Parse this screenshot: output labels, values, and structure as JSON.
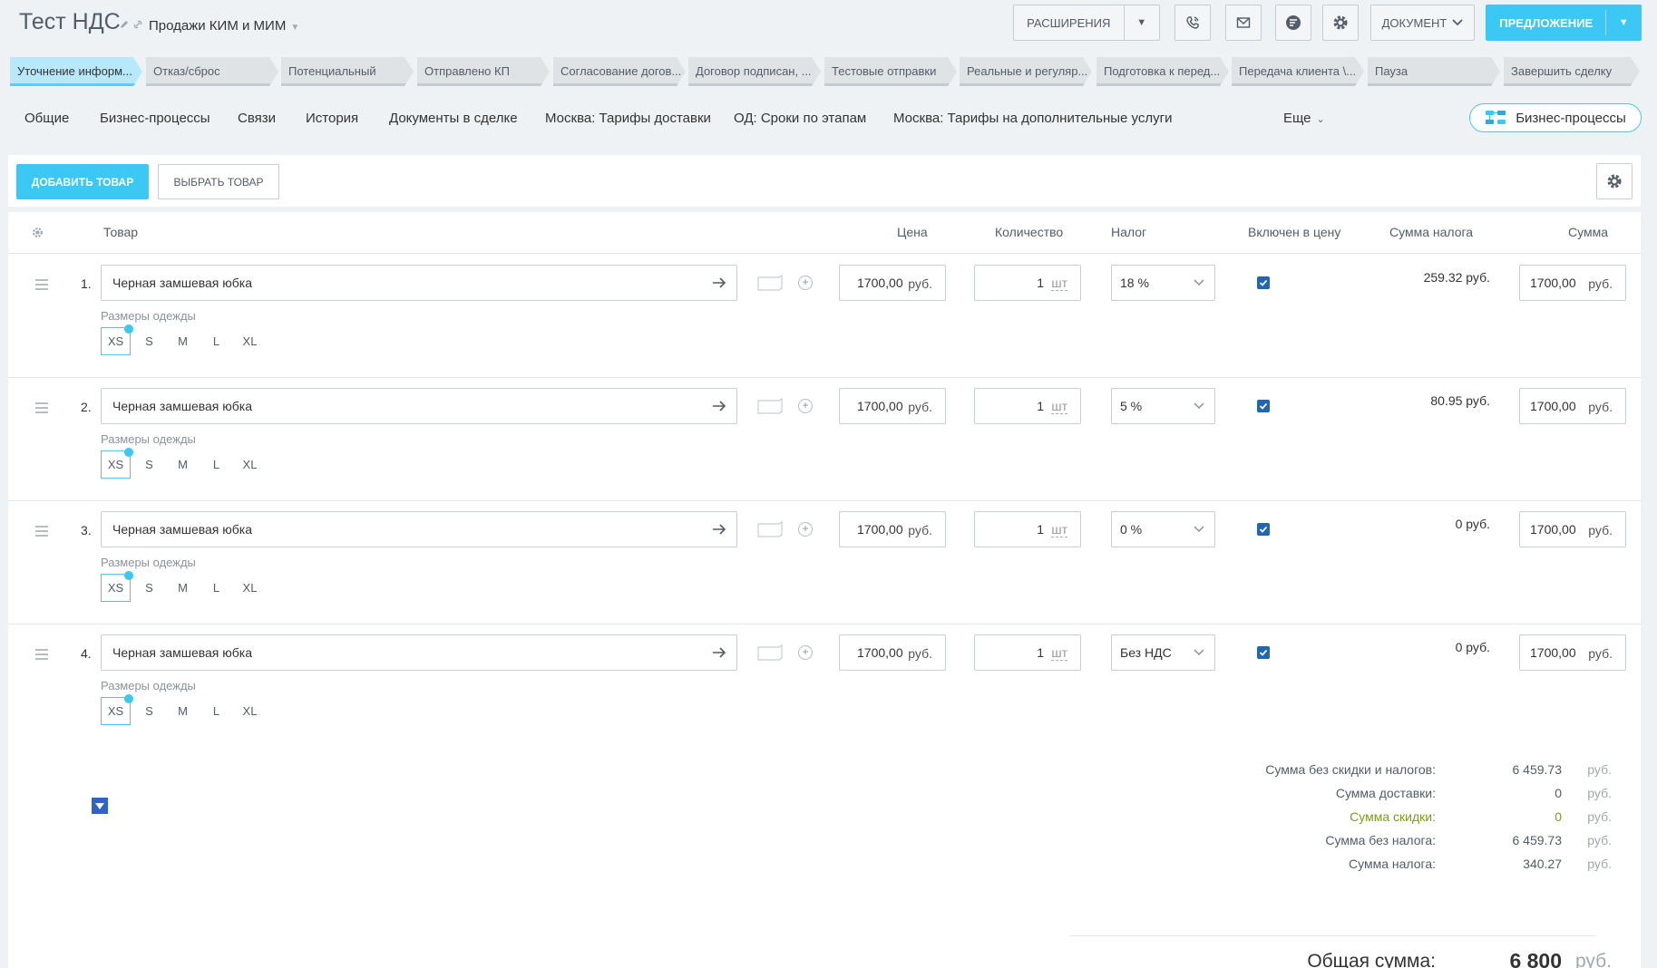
{
  "header": {
    "title": "Тест НДС",
    "pipeline": "Продажи КИМ и МИМ",
    "extensions_label": "Расширения",
    "document_label": "Документ",
    "offer_label": "Предложение"
  },
  "stages": [
    {
      "label": "Уточнение информ...",
      "active": true
    },
    {
      "label": "Отказ/сброс"
    },
    {
      "label": "Потенциальный"
    },
    {
      "label": "Отправлено КП"
    },
    {
      "label": "Согласование догов..."
    },
    {
      "label": "Договор подписан, ..."
    },
    {
      "label": "Тестовые отправки"
    },
    {
      "label": "Реальные и регуляр..."
    },
    {
      "label": "Подготовка к перед..."
    },
    {
      "label": "Передача клиента \\..."
    },
    {
      "label": "Пауза"
    },
    {
      "label": "Завершить сделку"
    }
  ],
  "tabs": [
    "Общие",
    "Бизнес-процессы",
    "Связи",
    "История",
    "Документы в сделке",
    "Москва: Тарифы доставки",
    "ОД: Сроки по этапам",
    "Москва: Тарифы на дополнительные услуги"
  ],
  "tabs_more": "Еще",
  "bp_button": "Бизнес-процессы",
  "toolbar": {
    "add_label": "Добавить товар",
    "select_label": "Выбрать товар"
  },
  "columns": {
    "product": "Товар",
    "price": "Цена",
    "quantity": "Количество",
    "tax": "Налог",
    "included": "Включен в цену",
    "tax_sum": "Сумма налога",
    "sum": "Сумма"
  },
  "products": [
    {
      "num": "1.",
      "name": "Черная замшевая юбка",
      "price": "1700,00",
      "currency": "руб.",
      "qty": "1",
      "unit": "шт",
      "tax": "18 %",
      "included": true,
      "tax_sum": "259.32 руб.",
      "sum": "1700,00",
      "prop_label": "Размеры одежды",
      "sizes": [
        "XS",
        "S",
        "M",
        "L",
        "XL"
      ],
      "selected_size": "XS"
    },
    {
      "num": "2.",
      "name": "Черная замшевая юбка",
      "price": "1700,00",
      "currency": "руб.",
      "qty": "1",
      "unit": "шт",
      "tax": "5 %",
      "included": true,
      "tax_sum": "80.95 руб.",
      "sum": "1700,00",
      "prop_label": "Размеры одежды",
      "sizes": [
        "XS",
        "S",
        "M",
        "L",
        "XL"
      ],
      "selected_size": "XS"
    },
    {
      "num": "3.",
      "name": "Черная замшевая юбка",
      "price": "1700,00",
      "currency": "руб.",
      "qty": "1",
      "unit": "шт",
      "tax": "0 %",
      "included": true,
      "tax_sum": "0 руб.",
      "sum": "1700,00",
      "prop_label": "Размеры одежды",
      "sizes": [
        "XS",
        "S",
        "M",
        "L",
        "XL"
      ],
      "selected_size": "XS"
    },
    {
      "num": "4.",
      "name": "Черная замшевая юбка",
      "price": "1700,00",
      "currency": "руб.",
      "qty": "1",
      "unit": "шт",
      "tax": "Без НДС",
      "included": true,
      "tax_sum": "0 руб.",
      "sum": "1700,00",
      "prop_label": "Размеры одежды",
      "sizes": [
        "XS",
        "S",
        "M",
        "L",
        "XL"
      ],
      "selected_size": "XS"
    }
  ],
  "totals": {
    "rows": [
      {
        "label": "Сумма без скидки и налогов:",
        "amount": "6 459.73",
        "currency": "руб."
      },
      {
        "label": "Сумма доставки:",
        "amount": "0",
        "currency": "руб."
      },
      {
        "label": "Сумма скидки:",
        "amount": "0",
        "currency": "руб.",
        "discount": true
      },
      {
        "label": "Сумма без налога:",
        "amount": "6 459.73",
        "currency": "руб."
      },
      {
        "label": "Сумма налога:",
        "amount": "340.27",
        "currency": "руб."
      }
    ],
    "grand_label": "Общая сумма:",
    "grand_amount": "6 800",
    "grand_currency": "руб."
  },
  "colors": {
    "accent": "#3bc8f5",
    "checkbox": "#2066b0",
    "discount": "#7c9c1f"
  }
}
